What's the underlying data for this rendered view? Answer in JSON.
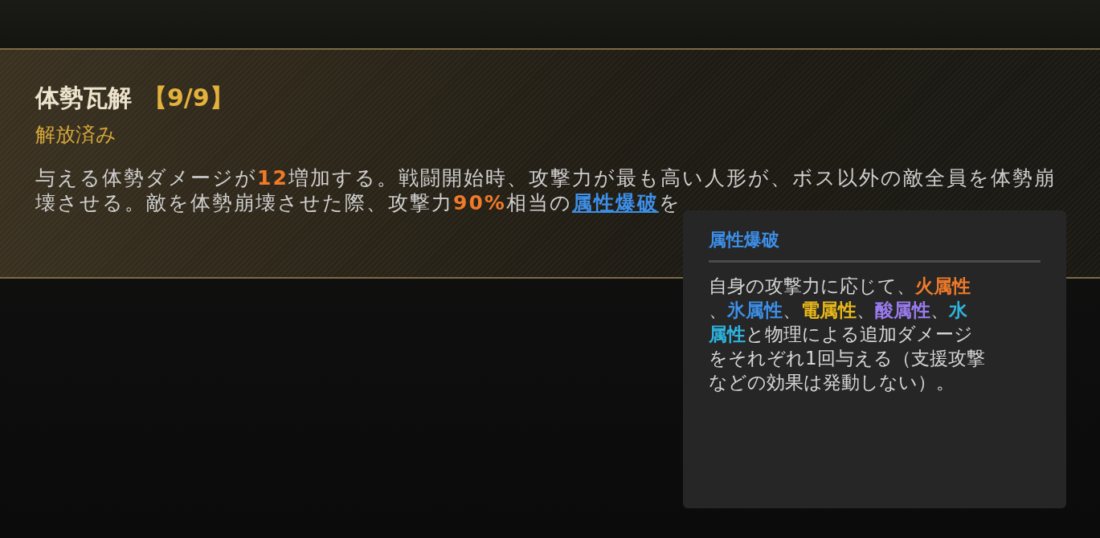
{
  "skill": {
    "name": "体勢瓦解",
    "rank": "【9/9】",
    "status": "解放済み",
    "description_lines": [
      [
        {
          "kind": "plain",
          "text": "与える体勢ダメージが"
        },
        {
          "kind": "highlight",
          "text": "12",
          "color": "#f07a2a"
        },
        {
          "kind": "plain",
          "text": "増加する。戦闘開始時、攻撃力が最も高い人形が、ボス以外の敵全員を体勢崩"
        }
      ],
      [
        {
          "kind": "plain",
          "text": "壊させる。敵を体勢崩壊させた際、攻撃力"
        },
        {
          "kind": "highlight",
          "text": "90%",
          "color": "#f07a2a"
        },
        {
          "kind": "plain",
          "text": "相当の"
        },
        {
          "kind": "link",
          "text": "属性爆破",
          "color": "#3d8fe8"
        },
        {
          "kind": "plain",
          "text": "を"
        }
      ]
    ]
  },
  "tooltip": {
    "title": "属性爆破",
    "lines": [
      [
        {
          "kind": "plain",
          "text": "自身の攻撃力に応じて、"
        },
        {
          "kind": "highlight",
          "text": "火属性",
          "color": "#f07a2a"
        }
      ],
      [
        {
          "kind": "plain",
          "text": "、"
        },
        {
          "kind": "highlight",
          "text": "氷属性",
          "color": "#3d8fe8"
        },
        {
          "kind": "plain",
          "text": "、"
        },
        {
          "kind": "highlight",
          "text": "電属性",
          "color": "#e8b81a"
        },
        {
          "kind": "plain",
          "text": "、"
        },
        {
          "kind": "highlight",
          "text": "酸属性",
          "color": "#9b7cf0"
        },
        {
          "kind": "plain",
          "text": "、"
        },
        {
          "kind": "highlight",
          "text": "水",
          "color": "#2fb4e0"
        }
      ],
      [
        {
          "kind": "highlight",
          "text": "属性",
          "color": "#2fb4e0"
        },
        {
          "kind": "plain",
          "text": "と物理による追加ダメージ"
        }
      ],
      [
        {
          "kind": "plain",
          "text": "をそれぞれ1回与える（支援攻撃"
        }
      ],
      [
        {
          "kind": "plain",
          "text": "などの効果は発動しない）。"
        }
      ]
    ]
  }
}
